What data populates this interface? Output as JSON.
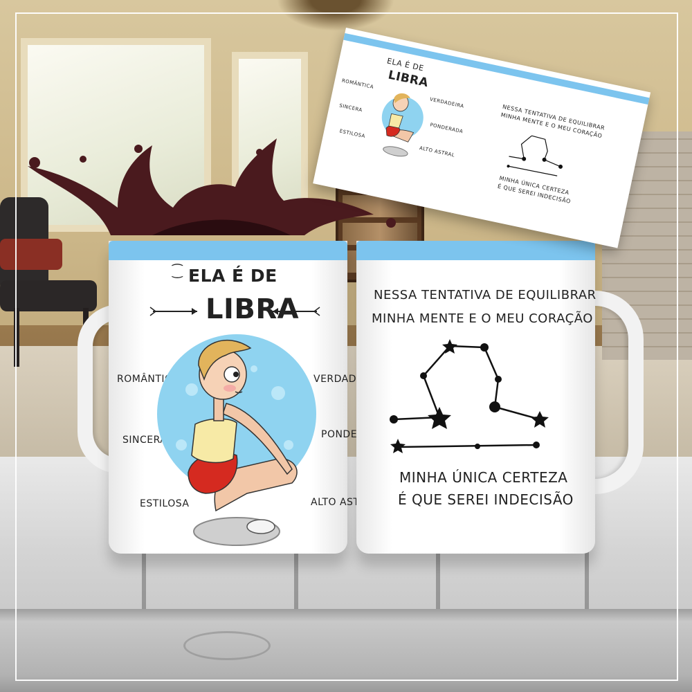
{
  "mug_front": {
    "heading": "ELA É DE",
    "sign": "LIBRA",
    "traits_left": [
      "ROMÂNTICA",
      "SINCERA",
      "ESTILOSA"
    ],
    "traits_right": [
      "VERDADEIRA",
      "PONDERADA",
      "ALTO ASTRAL"
    ]
  },
  "mug_back": {
    "line1": "NESSA TENTATIVA DE EQUILIBRAR",
    "line2": "MINHA MENTE E O MEU CORAÇÃO",
    "closing1": "MINHA ÚNICA CERTEZA",
    "closing2": "É QUE SEREI INDECISÃO"
  },
  "sheet": {
    "heading": "ELA É DE",
    "sign": "LIBRA",
    "traits_left": [
      "ROMÂNTICA",
      "SINCERA",
      "ESTILOSA"
    ],
    "traits_right": [
      "VERDADEIRA",
      "PONDERADA",
      "ALTO ASTRAL"
    ],
    "line1": "NESSA TENTATIVA DE EQUILIBRAR",
    "line2": "MINHA MENTE E O MEU CORAÇÃO",
    "closing1": "MINHA ÚNICA CERTEZA",
    "closing2": "É QUE SEREI INDECISÃO"
  },
  "colors": {
    "rim": "#7cc4ee",
    "bubble": "#8fd3f0",
    "coffee": "#4a1a1e",
    "hair": "#e2b45c",
    "shorts": "#d52a20"
  },
  "icons": [
    "arrow-left-icon",
    "arrow-right-icon",
    "star-icon",
    "scale-icon"
  ]
}
